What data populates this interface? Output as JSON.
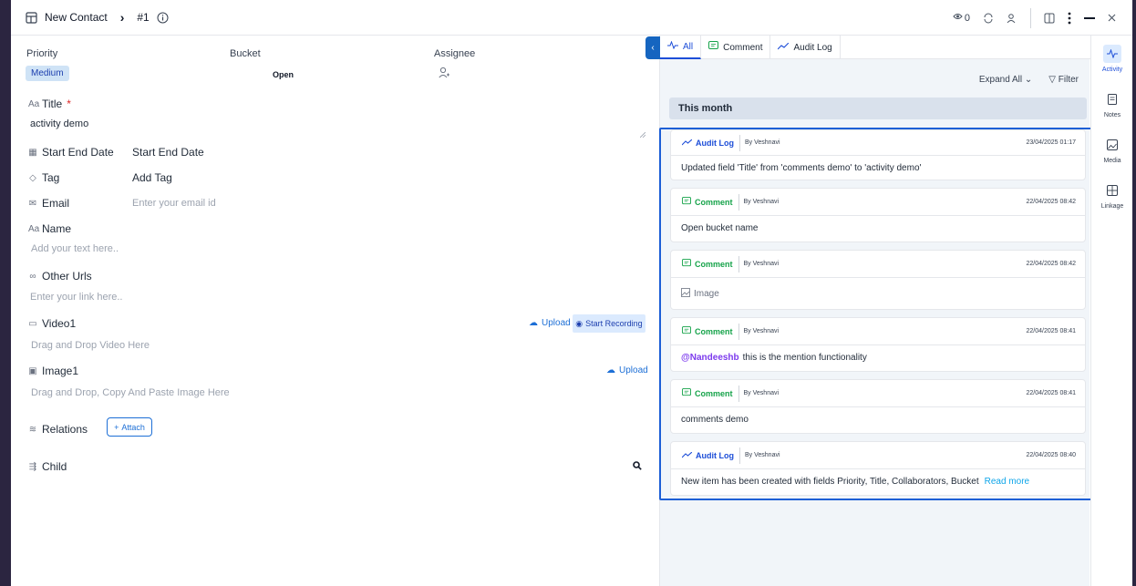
{
  "header": {
    "title": "New Contact",
    "record_id": "#1",
    "watch_count": "0"
  },
  "form": {
    "priority_label": "Priority",
    "priority_value": "Medium",
    "bucket_label": "Bucket",
    "bucket_value": "Open",
    "assignee_label": "Assignee",
    "title_label": "Title",
    "title_required": "*",
    "title_value": "activity demo",
    "start_end_label": "Start End Date",
    "start_end_value": "Start End Date",
    "tag_label": "Tag",
    "tag_value": "Add Tag",
    "email_label": "Email",
    "email_placeholder": "Enter your email id",
    "name_label": "Name",
    "name_placeholder": "Add your text here..",
    "urls_label": "Other Urls",
    "urls_placeholder": "Enter your link here..",
    "video_label": "Video1",
    "video_upload": "Upload",
    "video_record": "Start Recording",
    "video_drop": "Drag and Drop Video Here",
    "image_label": "Image1",
    "image_upload": "Upload",
    "image_drop": "Drag and Drop, Copy And Paste Image Here",
    "relations_label": "Relations",
    "attach_label": "Attach",
    "child_label": "Child"
  },
  "panel": {
    "tabs": [
      {
        "label": "All",
        "active": true
      },
      {
        "label": "Comment",
        "active": false
      },
      {
        "label": "Audit Log",
        "active": false
      }
    ],
    "expand_all": "Expand All",
    "filter": "Filter",
    "section": "This month",
    "activities": [
      {
        "type": "Audit Log",
        "by": "By Veshnavi",
        "date": "23/04/2025 01:17",
        "body": "Updated field 'Title' from 'comments demo' to 'activity demo'"
      },
      {
        "type": "Comment",
        "by": "By Veshnavi",
        "date": "22/04/2025 08:42",
        "body": "Open bucket name"
      },
      {
        "type": "Comment",
        "by": "By Veshnavi",
        "date": "22/04/2025 08:42",
        "body": "Image"
      },
      {
        "type": "Comment",
        "by": "By Veshnavi",
        "date": "22/04/2025 08:41",
        "mention": "@Nandeeshb",
        "body": "this is the mention functionality"
      },
      {
        "type": "Comment",
        "by": "By Veshnavi",
        "date": "22/04/2025 08:41",
        "body": "comments demo"
      },
      {
        "type": "Audit Log",
        "by": "By Veshnavi",
        "date": "22/04/2025 08:40",
        "body": "New item has been created with fields Priority, Title, Collaborators, Bucket",
        "more": "Read more"
      }
    ]
  },
  "rail": [
    {
      "label": "Activity",
      "icon": "activity-icon",
      "active": true
    },
    {
      "label": "Notes",
      "icon": "notes-icon",
      "active": false
    },
    {
      "label": "Media",
      "icon": "media-icon",
      "active": false
    },
    {
      "label": "Linkage",
      "icon": "linkage-icon",
      "active": false
    }
  ],
  "colors": {
    "accent": "#1d4ed8",
    "comment": "#16a34a",
    "highlight": "#1d5fd6"
  }
}
